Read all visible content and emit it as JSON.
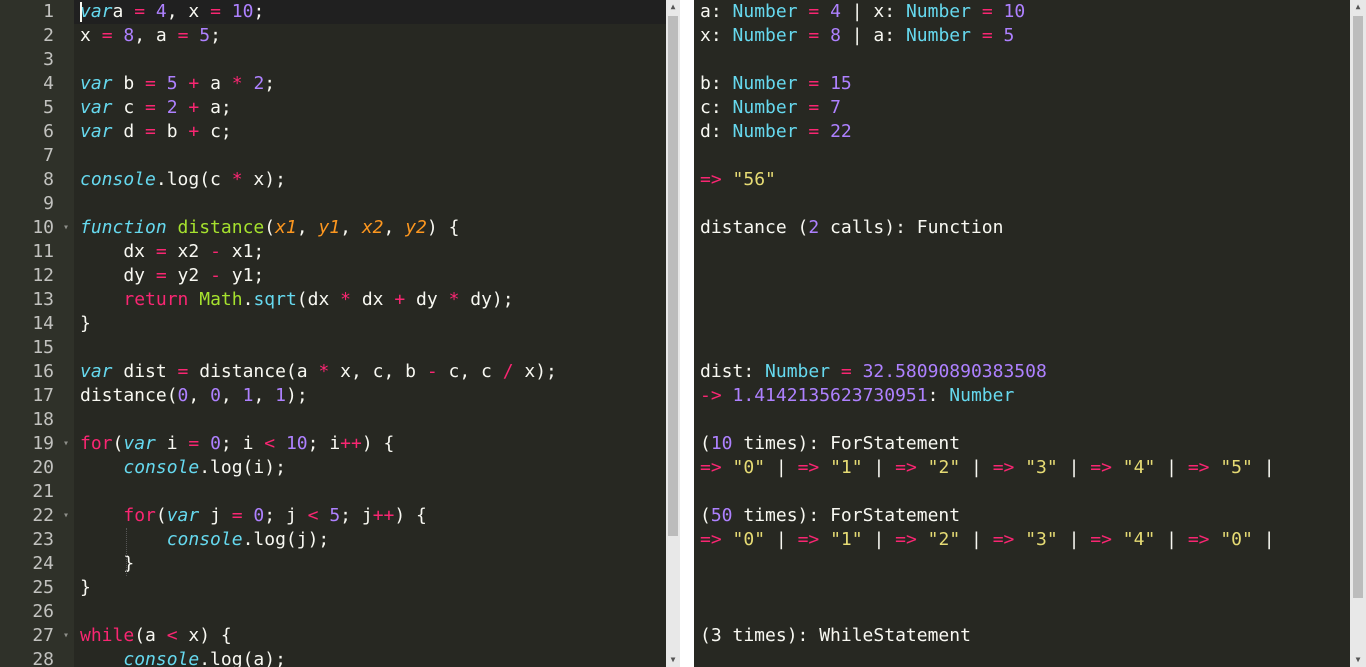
{
  "editor": {
    "lines": [
      {
        "n": "1",
        "fold": false,
        "t": [
          [
            "kw",
            "var"
          ],
          [
            "",
            "a "
          ],
          [
            "op",
            "="
          ],
          [
            "",
            "",
            ""
          ],
          [
            "nm",
            " 4"
          ],
          [
            "",
            ", x "
          ],
          [
            "op",
            "="
          ],
          [
            "nm",
            " 10"
          ],
          [
            "",
            ";"
          ]
        ]
      },
      {
        "n": "2",
        "fold": false,
        "t": [
          [
            "",
            "x "
          ],
          [
            "op",
            "="
          ],
          [
            "nm",
            " 8"
          ],
          [
            "",
            ", a "
          ],
          [
            "op",
            "="
          ],
          [
            "nm",
            " 5"
          ],
          [
            "",
            ";"
          ]
        ]
      },
      {
        "n": "3",
        "fold": false,
        "t": []
      },
      {
        "n": "4",
        "fold": false,
        "t": [
          [
            "kw",
            "var"
          ],
          [
            "",
            " b "
          ],
          [
            "op",
            "="
          ],
          [
            "nm",
            " 5"
          ],
          [
            "",
            " "
          ],
          [
            "op",
            "+"
          ],
          [
            "",
            " a "
          ],
          [
            "op",
            "*"
          ],
          [
            "nm",
            " 2"
          ],
          [
            "",
            ";"
          ]
        ]
      },
      {
        "n": "5",
        "fold": false,
        "t": [
          [
            "kw",
            "var"
          ],
          [
            "",
            " c "
          ],
          [
            "op",
            "="
          ],
          [
            "nm",
            " 2"
          ],
          [
            "",
            " "
          ],
          [
            "op",
            "+"
          ],
          [
            "",
            " a;"
          ]
        ]
      },
      {
        "n": "6",
        "fold": false,
        "t": [
          [
            "kw",
            "var"
          ],
          [
            "",
            " d "
          ],
          [
            "op",
            "="
          ],
          [
            "",
            " b "
          ],
          [
            "op",
            "+"
          ],
          [
            "",
            " c;"
          ]
        ]
      },
      {
        "n": "7",
        "fold": false,
        "t": []
      },
      {
        "n": "8",
        "fold": false,
        "t": [
          [
            "kw",
            "console"
          ],
          [
            "",
            ".log(c "
          ],
          [
            "op",
            "*"
          ],
          [
            "",
            " x);"
          ]
        ]
      },
      {
        "n": "9",
        "fold": false,
        "t": []
      },
      {
        "n": "10",
        "fold": true,
        "t": [
          [
            "kw",
            "function"
          ],
          [
            "",
            " "
          ],
          [
            "fn",
            "distance"
          ],
          [
            "",
            "("
          ],
          [
            "pm",
            "x1"
          ],
          [
            "",
            ", "
          ],
          [
            "pm",
            "y1"
          ],
          [
            "",
            ", "
          ],
          [
            "pm",
            "x2"
          ],
          [
            "",
            ", "
          ],
          [
            "pm",
            "y2"
          ],
          [
            "",
            ") {"
          ]
        ]
      },
      {
        "n": "11",
        "fold": false,
        "t": [
          [
            "",
            "    dx "
          ],
          [
            "op",
            "="
          ],
          [
            "",
            " x2 "
          ],
          [
            "op",
            "-"
          ],
          [
            "",
            " x1;"
          ]
        ]
      },
      {
        "n": "12",
        "fold": false,
        "t": [
          [
            "",
            "    dy "
          ],
          [
            "op",
            "="
          ],
          [
            "",
            " y2 "
          ],
          [
            "op",
            "-"
          ],
          [
            "",
            " y1;"
          ]
        ]
      },
      {
        "n": "13",
        "fold": false,
        "t": [
          [
            "",
            "    "
          ],
          [
            "op",
            "return"
          ],
          [
            "",
            " "
          ],
          [
            "fn",
            "Math"
          ],
          [
            "",
            "."
          ],
          [
            "ty",
            "sqrt"
          ],
          [
            "",
            "(dx "
          ],
          [
            "op",
            "*"
          ],
          [
            "",
            " dx "
          ],
          [
            "op",
            "+"
          ],
          [
            "",
            " dy "
          ],
          [
            "op",
            "*"
          ],
          [
            "",
            " dy);"
          ]
        ]
      },
      {
        "n": "14",
        "fold": false,
        "t": [
          [
            "",
            "}"
          ]
        ]
      },
      {
        "n": "15",
        "fold": false,
        "t": []
      },
      {
        "n": "16",
        "fold": false,
        "t": [
          [
            "kw",
            "var"
          ],
          [
            "",
            " dist "
          ],
          [
            "op",
            "="
          ],
          [
            "",
            " distance(a "
          ],
          [
            "op",
            "*"
          ],
          [
            "",
            " x, c, b "
          ],
          [
            "op",
            "-"
          ],
          [
            "",
            " c, c "
          ],
          [
            "op",
            "/"
          ],
          [
            "",
            " x);"
          ]
        ]
      },
      {
        "n": "17",
        "fold": false,
        "t": [
          [
            "",
            "distance("
          ],
          [
            "nm",
            "0"
          ],
          [
            "",
            ", "
          ],
          [
            "nm",
            "0"
          ],
          [
            "",
            ", "
          ],
          [
            "nm",
            "1"
          ],
          [
            "",
            ", "
          ],
          [
            "nm",
            "1"
          ],
          [
            "",
            ");"
          ]
        ]
      },
      {
        "n": "18",
        "fold": false,
        "t": []
      },
      {
        "n": "19",
        "fold": true,
        "t": [
          [
            "op",
            "for"
          ],
          [
            "",
            "("
          ],
          [
            "kw",
            "var"
          ],
          [
            "",
            " i "
          ],
          [
            "op",
            "="
          ],
          [
            "nm",
            " 0"
          ],
          [
            "",
            "; i "
          ],
          [
            "op",
            "<"
          ],
          [
            "nm",
            " 10"
          ],
          [
            "",
            "; i"
          ],
          [
            "op",
            "++"
          ],
          [
            "",
            ") {"
          ]
        ]
      },
      {
        "n": "20",
        "fold": false,
        "t": [
          [
            "",
            "    "
          ],
          [
            "kw",
            "console"
          ],
          [
            "",
            ".log(i);"
          ]
        ]
      },
      {
        "n": "21",
        "fold": false,
        "t": []
      },
      {
        "n": "22",
        "fold": true,
        "t": [
          [
            "",
            "    "
          ],
          [
            "op",
            "for"
          ],
          [
            "",
            "("
          ],
          [
            "kw",
            "var"
          ],
          [
            "",
            " j "
          ],
          [
            "op",
            "="
          ],
          [
            "nm",
            " 0"
          ],
          [
            "",
            "; j "
          ],
          [
            "op",
            "<"
          ],
          [
            "nm",
            " 5"
          ],
          [
            "",
            "; j"
          ],
          [
            "op",
            "++"
          ],
          [
            "",
            ") {"
          ]
        ]
      },
      {
        "n": "23",
        "fold": false,
        "t": [
          [
            "",
            "        "
          ],
          [
            "kw",
            "console"
          ],
          [
            "",
            ".log(j);"
          ]
        ]
      },
      {
        "n": "24",
        "fold": false,
        "t": [
          [
            "",
            "    }"
          ]
        ]
      },
      {
        "n": "25",
        "fold": false,
        "t": [
          [
            "",
            "}"
          ]
        ]
      },
      {
        "n": "26",
        "fold": false,
        "t": []
      },
      {
        "n": "27",
        "fold": true,
        "t": [
          [
            "op",
            "while"
          ],
          [
            "",
            "(a "
          ],
          [
            "op",
            "<"
          ],
          [
            "",
            " x) {"
          ]
        ]
      },
      {
        "n": "28",
        "fold": false,
        "t": [
          [
            "",
            "    "
          ],
          [
            "kw",
            "console"
          ],
          [
            "",
            ".log(a);"
          ]
        ]
      }
    ]
  },
  "output": {
    "lines": [
      {
        "row": 1,
        "t": [
          [
            "",
            "a: "
          ],
          [
            "ty",
            "Number"
          ],
          [
            "",
            " "
          ],
          [
            "op",
            "="
          ],
          [
            "nm",
            " 4"
          ],
          [
            "",
            " | x: "
          ],
          [
            "ty",
            "Number"
          ],
          [
            "",
            " "
          ],
          [
            "op",
            "="
          ],
          [
            "nm",
            " 10"
          ]
        ]
      },
      {
        "row": 2,
        "t": [
          [
            "",
            "x: "
          ],
          [
            "ty",
            "Number"
          ],
          [
            "",
            " "
          ],
          [
            "op",
            "="
          ],
          [
            "nm",
            " 8"
          ],
          [
            "",
            " | a: "
          ],
          [
            "ty",
            "Number"
          ],
          [
            "",
            " "
          ],
          [
            "op",
            "="
          ],
          [
            "nm",
            " 5"
          ]
        ]
      },
      {
        "row": 4,
        "t": [
          [
            "",
            "b: "
          ],
          [
            "ty",
            "Number"
          ],
          [
            "",
            " "
          ],
          [
            "op",
            "="
          ],
          [
            "nm",
            " 15"
          ]
        ]
      },
      {
        "row": 5,
        "t": [
          [
            "",
            "c: "
          ],
          [
            "ty",
            "Number"
          ],
          [
            "",
            " "
          ],
          [
            "op",
            "="
          ],
          [
            "nm",
            " 7"
          ]
        ]
      },
      {
        "row": 6,
        "t": [
          [
            "",
            "d: "
          ],
          [
            "ty",
            "Number"
          ],
          [
            "",
            " "
          ],
          [
            "op",
            "="
          ],
          [
            "nm",
            " 22"
          ]
        ]
      },
      {
        "row": 8,
        "t": [
          [
            "op",
            "=>"
          ],
          [
            "st",
            " \"56\""
          ]
        ]
      },
      {
        "row": 10,
        "t": [
          [
            "",
            "distance ("
          ],
          [
            "nm",
            "2"
          ],
          [
            "",
            " calls): Function"
          ]
        ]
      },
      {
        "row": 16,
        "t": [
          [
            "",
            "dist: "
          ],
          [
            "ty",
            "Number"
          ],
          [
            "",
            " "
          ],
          [
            "op",
            "="
          ],
          [
            "nm",
            " 32.58090890383508"
          ]
        ]
      },
      {
        "row": 17,
        "t": [
          [
            "op",
            "->"
          ],
          [
            "nm",
            " 1.4142135623730951"
          ],
          [
            "",
            ": "
          ],
          [
            "ty",
            "Number"
          ]
        ]
      },
      {
        "row": 19,
        "t": [
          [
            "",
            "("
          ],
          [
            "nm",
            "10"
          ],
          [
            "",
            " times): ForStatement"
          ]
        ]
      },
      {
        "row": 20,
        "t": [
          [
            "op",
            "=>"
          ],
          [
            "st",
            " \"0\""
          ],
          [
            "",
            " | "
          ],
          [
            "op",
            "=>"
          ],
          [
            "st",
            " \"1\""
          ],
          [
            "",
            " | "
          ],
          [
            "op",
            "=>"
          ],
          [
            "st",
            " \"2\""
          ],
          [
            "",
            " | "
          ],
          [
            "op",
            "=>"
          ],
          [
            "st",
            " \"3\""
          ],
          [
            "",
            " | "
          ],
          [
            "op",
            "=>"
          ],
          [
            "st",
            " \"4\""
          ],
          [
            "",
            " | "
          ],
          [
            "op",
            "=>"
          ],
          [
            "st",
            " \"5\""
          ],
          [
            "",
            " |"
          ]
        ]
      },
      {
        "row": 22,
        "t": [
          [
            "",
            "("
          ],
          [
            "nm",
            "50"
          ],
          [
            "",
            " times): ForStatement"
          ]
        ]
      },
      {
        "row": 23,
        "t": [
          [
            "op",
            "=>"
          ],
          [
            "st",
            " \"0\""
          ],
          [
            "",
            " | "
          ],
          [
            "op",
            "=>"
          ],
          [
            "st",
            " \"1\""
          ],
          [
            "",
            " | "
          ],
          [
            "op",
            "=>"
          ],
          [
            "st",
            " \"2\""
          ],
          [
            "",
            " | "
          ],
          [
            "op",
            "=>"
          ],
          [
            "st",
            " \"3\""
          ],
          [
            "",
            " | "
          ],
          [
            "op",
            "=>"
          ],
          [
            "st",
            " \"4\""
          ],
          [
            "",
            " | "
          ],
          [
            "op",
            "=>"
          ],
          [
            "st",
            " \"0\""
          ],
          [
            "",
            " |"
          ]
        ]
      },
      {
        "row": 27,
        "t": [
          [
            "",
            "(3 times): WhileStatement"
          ]
        ]
      }
    ]
  },
  "colors": {
    "background": "#272822",
    "gutter": "#2f3129",
    "keyword": "#66d9ef",
    "function": "#a6e22e",
    "operator": "#f92672",
    "number": "#ae81ff",
    "param": "#fd971f",
    "string": "#e6db74"
  }
}
